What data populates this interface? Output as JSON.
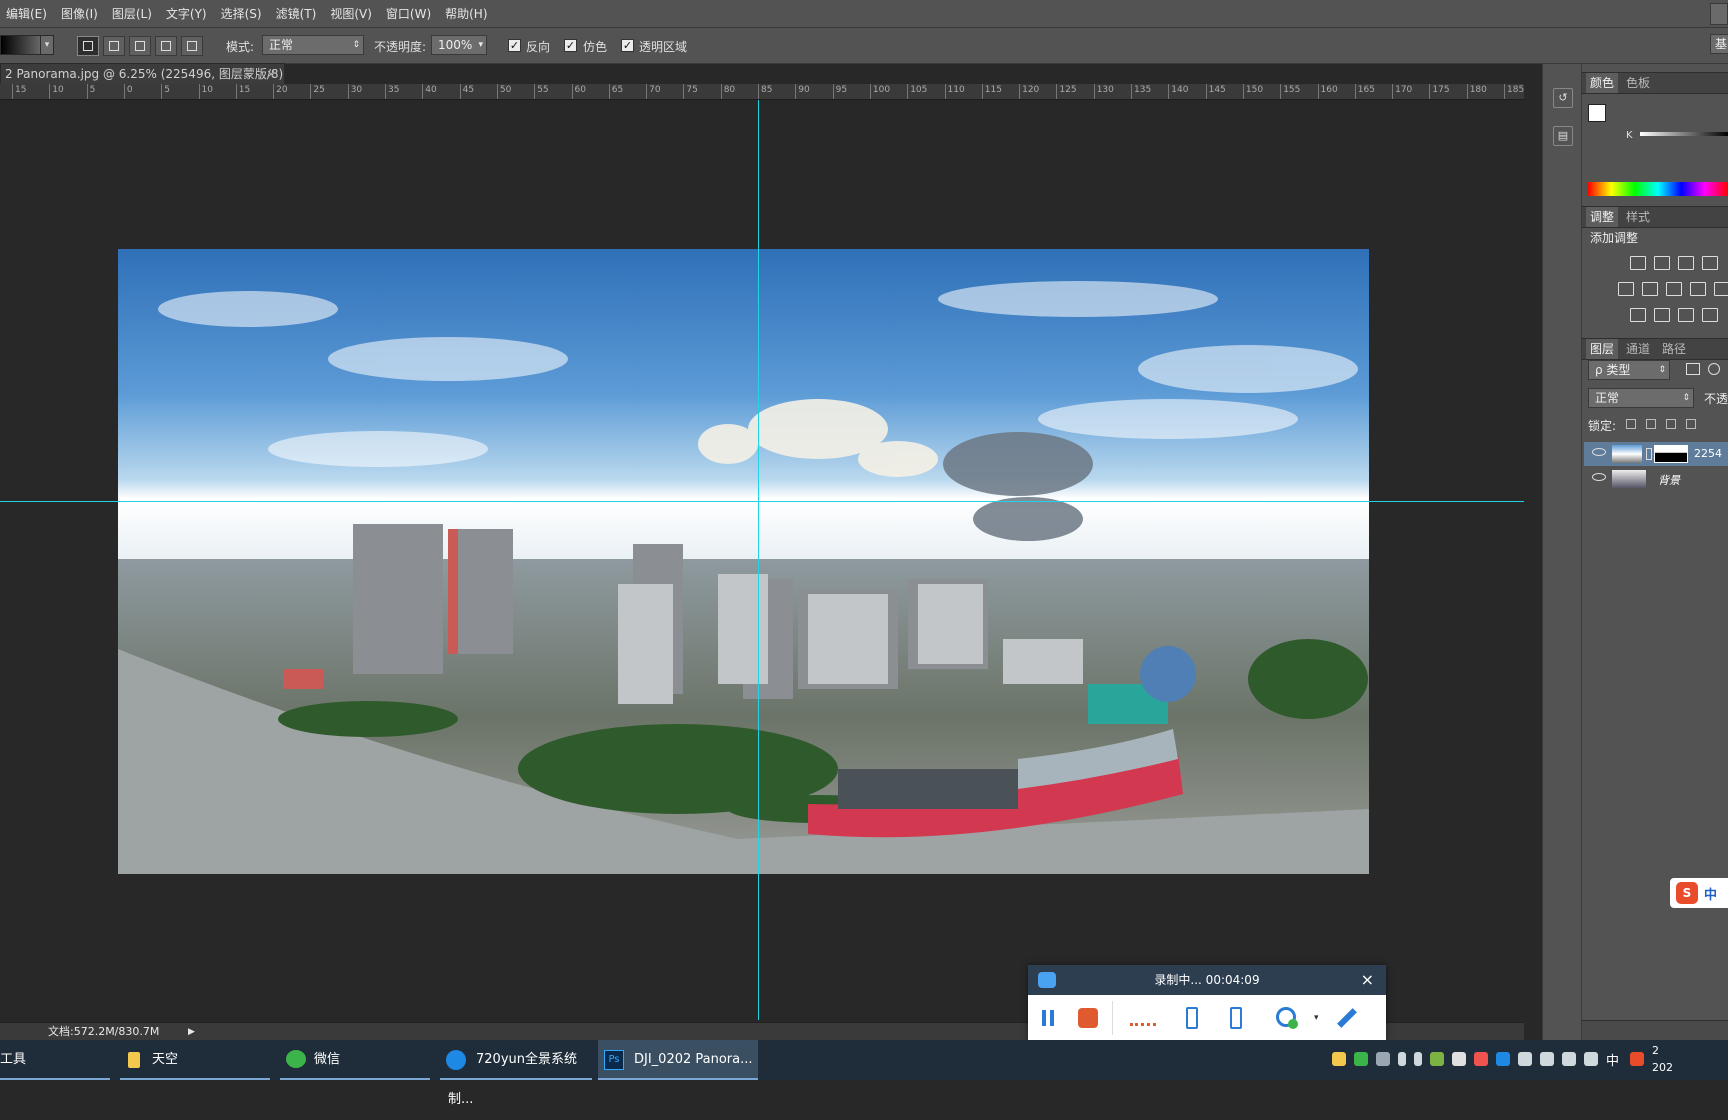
{
  "menu": [
    "编辑(E)",
    "图像(I)",
    "图层(L)",
    "文字(Y)",
    "选择(S)",
    "滤镜(T)",
    "视图(V)",
    "窗口(W)",
    "帮助(H)"
  ],
  "options": {
    "mode_label": "模式:",
    "mode_value": "正常",
    "opacity_label": "不透明度:",
    "opacity_value": "100%",
    "reverse_label": "反向",
    "dither_label": "仿色",
    "transparency_label": "透明区域",
    "right_button": "基"
  },
  "document": {
    "tab_title": "2 Panorama.jpg @ 6.25% (225496, 图层蒙版/8) *",
    "close": "×",
    "ruler_ticks": [
      "15",
      "10",
      "5",
      "0",
      "5",
      "10",
      "15",
      "20",
      "25",
      "30",
      "35",
      "40",
      "45",
      "50",
      "55",
      "60",
      "65",
      "70",
      "75",
      "80",
      "85",
      "90",
      "95",
      "100",
      "105",
      "110",
      "115",
      "120",
      "125",
      "130",
      "135",
      "140",
      "145",
      "150",
      "155",
      "160",
      "165",
      "170",
      "175",
      "180",
      "185"
    ]
  },
  "panels": {
    "color_tab": "颜色",
    "swatches_tab": "色板",
    "k_label": "K",
    "adjust_tab": "调整",
    "styles_tab": "样式",
    "add_adjust": "添加调整",
    "layers_tab": "图层",
    "channels_tab": "通道",
    "paths_tab": "路径",
    "kind_filter": "ρ 类型",
    "blend_mode": "正常",
    "opacity_short": "不透",
    "lock_label": "锁定:",
    "layers": [
      {
        "name": "2254"
      },
      {
        "name": "背景"
      }
    ]
  },
  "status": {
    "doc_size": "文档:572.2M/830.7M"
  },
  "recorder": {
    "status": "录制中... 00:04:09",
    "close": "×"
  },
  "taskbar": {
    "items": [
      {
        "label": "工具"
      },
      {
        "label": "天空"
      },
      {
        "label": "微信"
      },
      {
        "label": "720yun全景系统制..."
      },
      {
        "label": "DJI_0202 Panora..."
      }
    ],
    "tray_ime": "中",
    "clock_line1": "2",
    "clock_line2": "202"
  },
  "colors": {
    "guide": "#22d3e6",
    "ui_gray": "#535353",
    "canvas_bg": "#282828",
    "taskbar": "#1f2d3a"
  }
}
